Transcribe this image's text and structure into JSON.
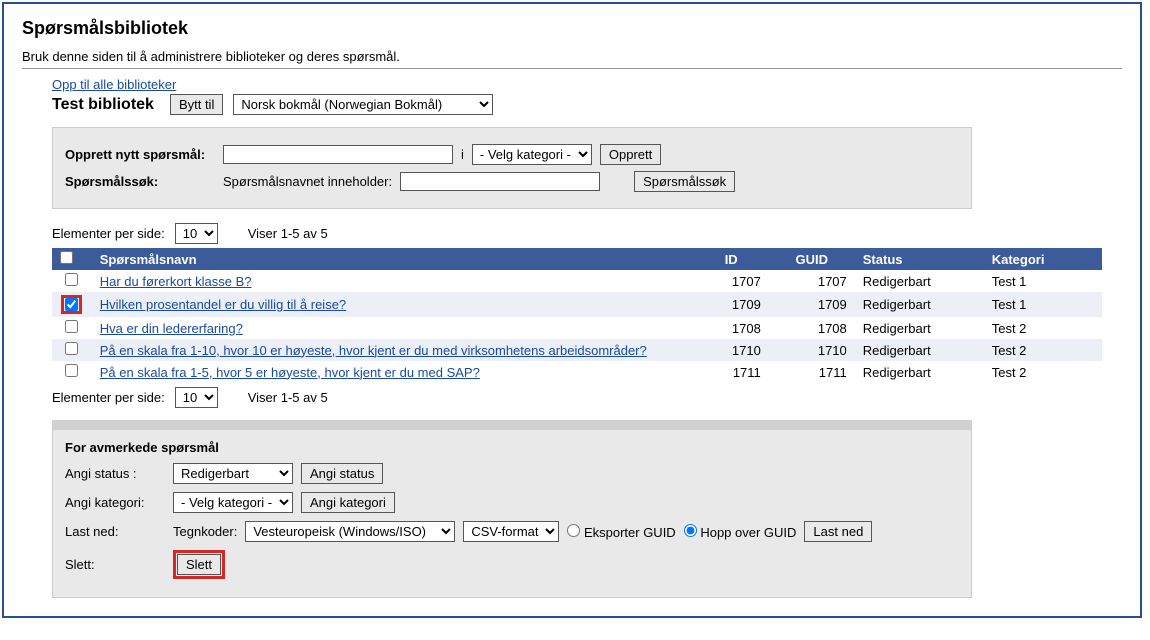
{
  "page": {
    "title": "Spørsmålsbibliotek",
    "subtitle": "Bruk denne siden til å administrere biblioteker og deres spørsmål."
  },
  "nav": {
    "up_link": "Opp til alle biblioteker"
  },
  "library": {
    "name": "Test bibliotek",
    "switch_button": "Bytt til",
    "language_options": [
      "Norsk bokmål (Norwegian Bokmål)"
    ],
    "language_selected": "Norsk bokmål (Norwegian Bokmål)"
  },
  "create": {
    "label": "Opprett nytt spørsmål:",
    "value": "",
    "in_label": "i",
    "category_placeholder": "- Velg kategori -",
    "submit": "Opprett"
  },
  "search": {
    "label": "Spørsmålssøk:",
    "contains_label": "Spørsmålsnavnet inneholder:",
    "value": "",
    "submit": "Spørsmålssøk"
  },
  "pager": {
    "per_page_label": "Elementer per side:",
    "per_page_value": "10",
    "showing": "Viser 1-5 av 5"
  },
  "table": {
    "headers": {
      "name": "Spørsmålsnavn",
      "id": "ID",
      "guid": "GUID",
      "status": "Status",
      "category": "Kategori"
    },
    "rows": [
      {
        "checked": false,
        "highlight": false,
        "name": "Har du førerkort klasse B?",
        "id": "1707",
        "guid": "1707",
        "status": "Redigerbart",
        "category": "Test 1"
      },
      {
        "checked": true,
        "highlight": true,
        "name": "Hvilken prosentandel er du villig til å reise?",
        "id": "1709",
        "guid": "1709",
        "status": "Redigerbart",
        "category": "Test 1"
      },
      {
        "checked": false,
        "highlight": false,
        "name": "Hva er din ledererfaring?",
        "id": "1708",
        "guid": "1708",
        "status": "Redigerbart",
        "category": "Test 2"
      },
      {
        "checked": false,
        "highlight": false,
        "name": "På en skala fra 1-10, hvor 10 er høyeste, hvor kjent er du med virksomhetens arbeidsområder?",
        "id": "1710",
        "guid": "1710",
        "status": "Redigerbart",
        "category": "Test 2"
      },
      {
        "checked": false,
        "highlight": false,
        "name": "På en skala fra 1-5, hvor 5 er høyeste, hvor kjent er du med SAP?",
        "id": "1711",
        "guid": "1711",
        "status": "Redigerbart",
        "category": "Test 2"
      }
    ]
  },
  "actions": {
    "header": "For avmerkede spørsmål",
    "status_label": "Angi status :",
    "status_value": "Redigerbart",
    "status_button": "Angi status",
    "category_label": "Angi kategori:",
    "category_placeholder": "- Velg kategori -",
    "category_button": "Angi kategori",
    "download_label": "Last ned:",
    "encoding_label": "Tegnkoder:",
    "encoding_value": "Vesteuropeisk (Windows/ISO)",
    "format_value": "CSV-format",
    "export_guid": "Eksporter GUID",
    "skip_guid": "Hopp over GUID",
    "guid_selected": "skip",
    "download_button": "Last ned",
    "delete_label": "Slett:",
    "delete_button": "Slett"
  }
}
